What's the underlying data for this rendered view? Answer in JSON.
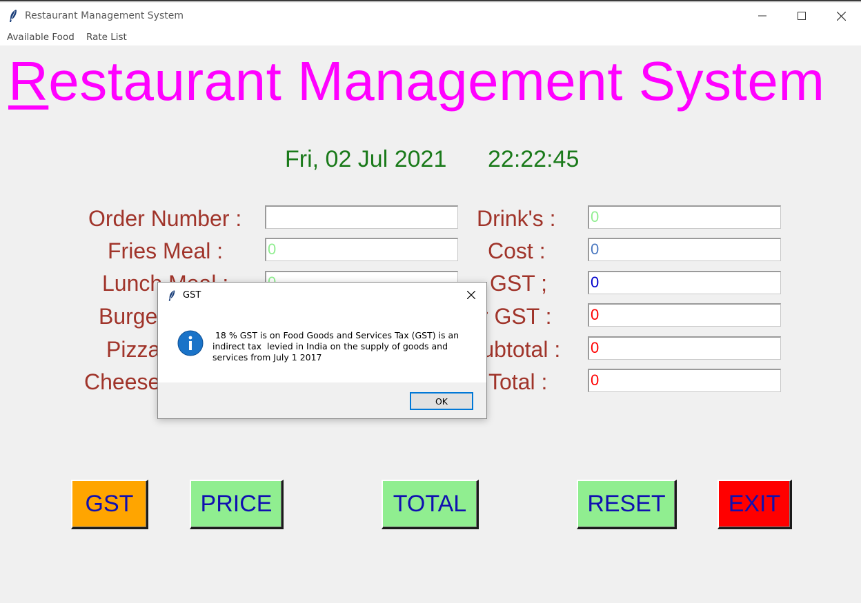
{
  "window": {
    "title": "Restaurant Management System"
  },
  "menu": [
    "Available Food",
    "Rate List"
  ],
  "heading": {
    "first_letter": "R",
    "rest": "estaurant Management System"
  },
  "datetime": {
    "date": "Fri, 02 Jul 2021",
    "time": "22:22:45"
  },
  "left_fields": [
    {
      "label": "Order Number :",
      "value": ""
    },
    {
      "label": "Fries Meal :",
      "value": "0"
    },
    {
      "label": "Lunch Meal :",
      "value": "0"
    },
    {
      "label": "Burger Meal :",
      "value": ""
    },
    {
      "label": "Pizza Meal :",
      "value": ""
    },
    {
      "label": "Cheese Burger :",
      "value": ""
    }
  ],
  "right_fields": [
    {
      "label": "Drink's :",
      "value": "0"
    },
    {
      "label": "Cost :",
      "value": "0"
    },
    {
      "label": "GST ;",
      "value": "0"
    },
    {
      "label": "After GST :",
      "value": "0"
    },
    {
      "label": "Subtotal :",
      "value": "0"
    },
    {
      "label": "Total :",
      "value": "0"
    }
  ],
  "buttons": {
    "gst": "GST",
    "price": "PRICE",
    "total": "TOTAL",
    "reset": "RESET",
    "exit": "EXIT"
  },
  "dialog": {
    "title": "GST",
    "message": " 18 % GST is on Food Goods and Services Tax (GST) is an\nindirect tax  levied in India on the supply of goods and\nservices from July 1 2017",
    "ok": "OK"
  },
  "colors": {
    "heading": "#ff00ff",
    "date": "#1a7a1a",
    "label": "#a0342a",
    "button_text": "#1010b0",
    "gst_button": "#ffa500",
    "green_button": "#90ee90",
    "exit_button": "#ff0000"
  }
}
